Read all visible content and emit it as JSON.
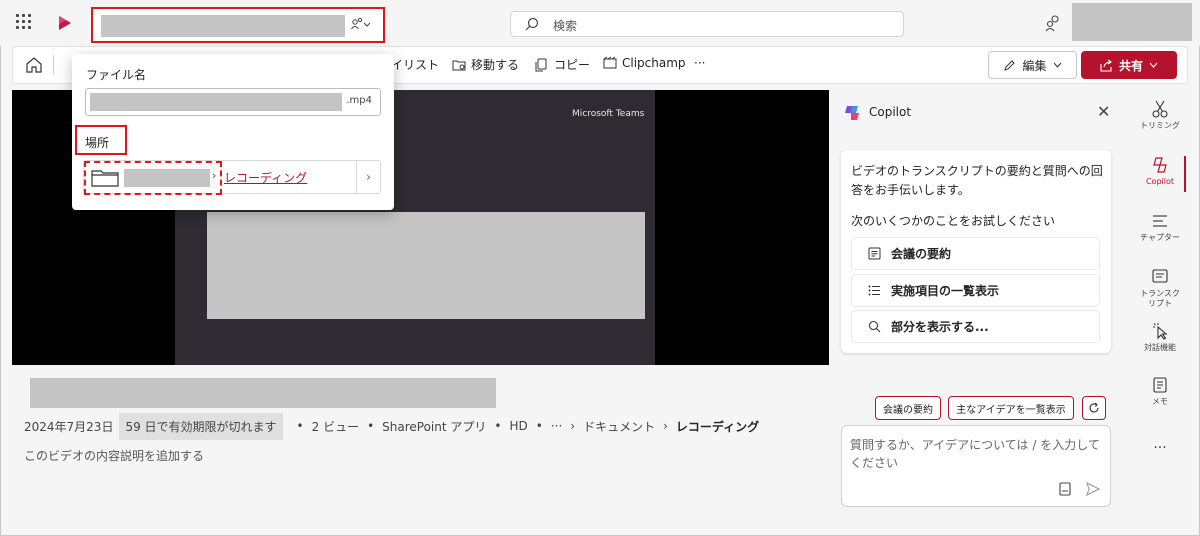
{
  "topbar": {
    "search_placeholder": "検索",
    "share_icon_label": "ഴ"
  },
  "commandbar": {
    "items": [
      "イリスト",
      "移動する",
      "コピー",
      "Clipchamp",
      "···"
    ],
    "edit_label": "編集",
    "share_label": "共有"
  },
  "video": {
    "brand_text": "Microsoft Teams"
  },
  "details": {
    "date": "2024年7月23日",
    "expiry_badge": "59 日で有効期限が切れます",
    "views": "2 ビュー",
    "source": "SharePoint アプリ",
    "quality": "HD",
    "more": "···",
    "crumb_1": "ドキュメント",
    "crumb_2": "レコーディング",
    "description_prompt": "このビデオの内容説明を追加する"
  },
  "filepanel": {
    "filename_label": "ファイル名",
    "extension": ".mp4",
    "location_label": "場所",
    "location_link": "レコーディング"
  },
  "copilot": {
    "title": "Copilot",
    "intro": "ビデオのトランスクリプトの要約と質問への回答をお手伝いします。",
    "try_label": "次のいくつかのことをお試しください",
    "actions": [
      "会議の要約",
      "実施項目の一覧表示",
      "部分を表示する..."
    ],
    "chips": [
      "会議の要約",
      "主なアイデアを一覧表示"
    ],
    "input_placeholder": "質問するか、アイデアについては / を入力してください"
  },
  "rail": {
    "items": [
      "トリミング",
      "Copilot",
      "チャプター",
      "トランスクリプト",
      "対話機能",
      "メモ"
    ],
    "transcript_line1": "トランスク",
    "transcript_line2": "リプト",
    "more": "···"
  },
  "colors": {
    "accent": "#b4122d",
    "highlight": "#e0161b"
  }
}
